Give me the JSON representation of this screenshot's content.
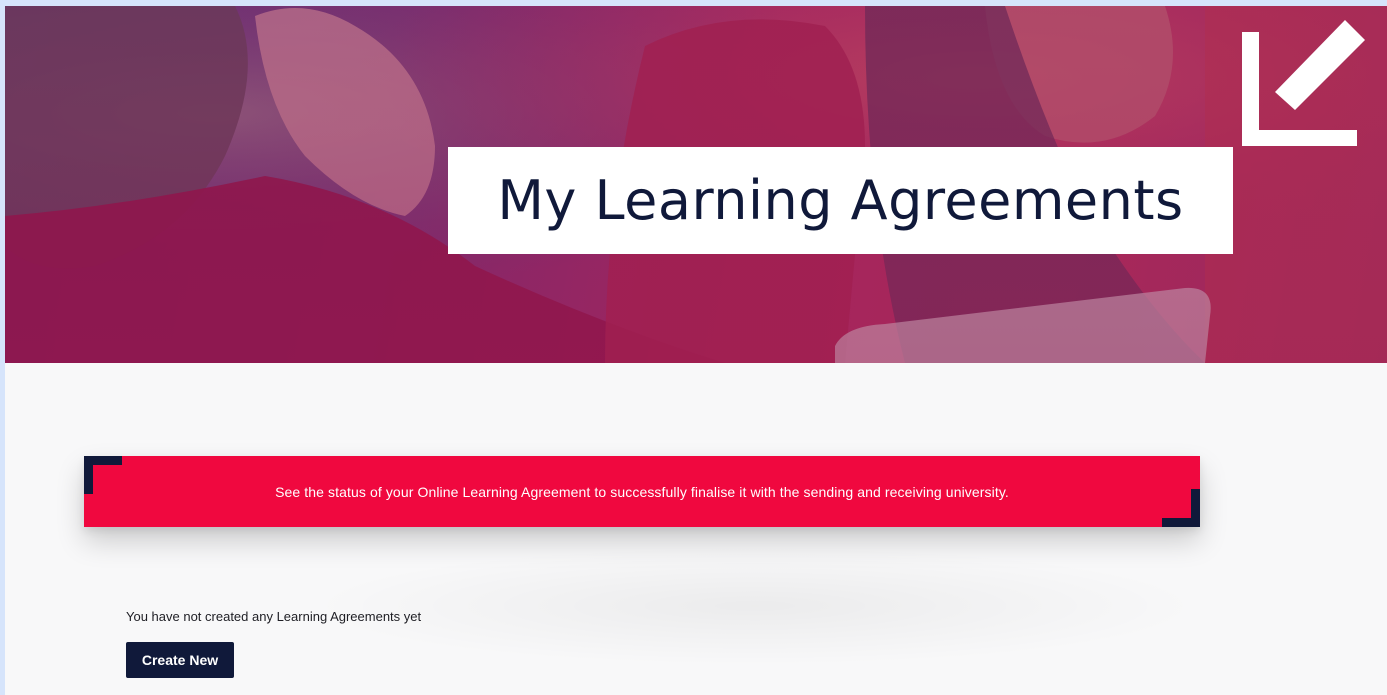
{
  "hero": {
    "title": "My Learning Agreements",
    "image": "students-photo",
    "logo": "checkmark-logo"
  },
  "banner": {
    "text": "See the status of your Online Learning Agreement to successfully finalise it with the sending and receiving university.",
    "color": "#f0083f",
    "corner_color": "#10193a"
  },
  "main": {
    "empty_message": "You have not created any Learning Agreements yet",
    "create_button_label": "Create New"
  },
  "colors": {
    "navy": "#10193a",
    "accent": "#f0083f",
    "page_bg": "#f8f8f9"
  }
}
